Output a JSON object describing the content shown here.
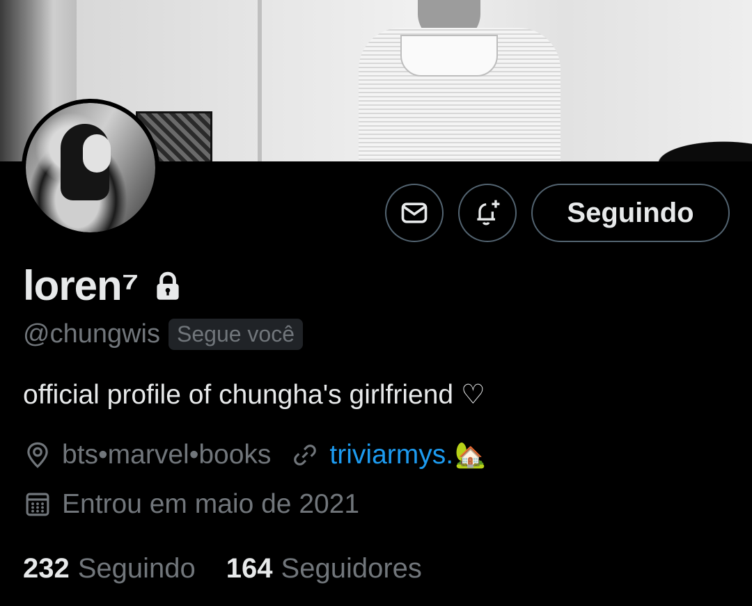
{
  "profile": {
    "display_name": "loren⁷",
    "handle": "@chungwis",
    "follows_you_badge": "Segue você",
    "bio": "official profile of chungha's girlfriend ♡",
    "location": "bts•marvel•books",
    "website": "triviarmys.",
    "website_emoji": "🏡",
    "joined": "Entrou em maio de 2021"
  },
  "actions": {
    "follow_label": "Seguindo"
  },
  "stats": {
    "following_count": "232",
    "following_label": "Seguindo",
    "followers_count": "164",
    "followers_label": "Seguidores"
  },
  "colors": {
    "background": "#000000",
    "text_primary": "#e7e9ea",
    "text_secondary": "#71767b",
    "link": "#1d9bf0",
    "border": "#536471"
  },
  "icons": [
    "message-icon",
    "notification-bell-icon",
    "lock-icon",
    "location-pin-icon",
    "link-icon",
    "calendar-icon"
  ]
}
